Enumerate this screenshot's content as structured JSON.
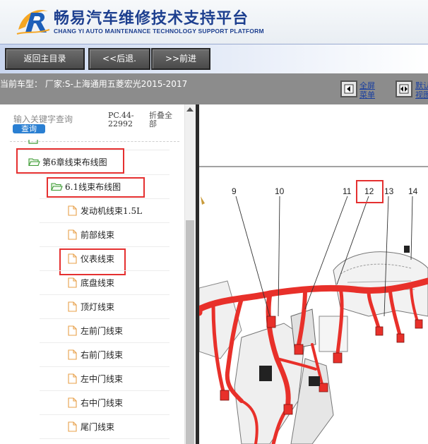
{
  "header": {
    "title": "畅易汽车维修技术支持平台",
    "subtitle": "CHANG YI AUTO MAINTENANCE TECHNOLOGY SUPPORT PLATFORM"
  },
  "nav": {
    "home_label": "返回主目录",
    "back_label": "<<后退.",
    "forward_label": ">>前进"
  },
  "status": {
    "current_vehicle": "当前车型： 厂家:S-上海通用五菱宏光2015-2017",
    "fullscreen_label_1": "全屏",
    "fullscreen_label_2": "菜单",
    "default_label_1": "默认",
    "default_label_2": "视图"
  },
  "search": {
    "placeholder": "输入关键字查询",
    "button_label": "查询",
    "code_line1": "PC.44-",
    "code_line2": "22992",
    "collapse_line1": "折叠全",
    "collapse_line2": "部"
  },
  "tree": {
    "chapter": "第6章线束布线图",
    "section": "6.1线束布线图",
    "items": [
      "发动机线束1.5L",
      "前部线束",
      "仪表线束",
      "底盘线束",
      "顶灯线束",
      "左前门线束",
      "右前门线束",
      "左中门线束",
      "右中门线束",
      "尾门线束"
    ]
  },
  "diagram": {
    "callouts": [
      "9",
      "10",
      "11",
      "12",
      "13",
      "14"
    ],
    "harness_color": "#e8302a"
  },
  "colors": {
    "brand_blue": "#1d3f8f",
    "highlight_red": "#e53030",
    "search_blue": "#2a7fd2",
    "status_gray": "#8c8c8c"
  }
}
